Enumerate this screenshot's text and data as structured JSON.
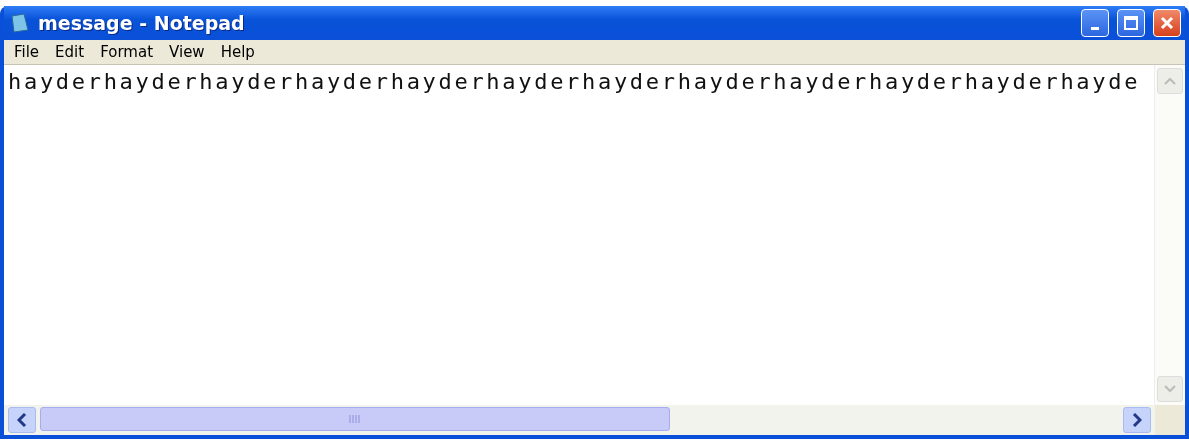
{
  "window": {
    "title": "message - Notepad"
  },
  "menu": [
    "File",
    "Edit",
    "Format",
    "View",
    "Help"
  ],
  "editor": {
    "text": "hayderhayderhayderhayderhayderhayderhayderhayderhayderhayderhayderhayde"
  }
}
